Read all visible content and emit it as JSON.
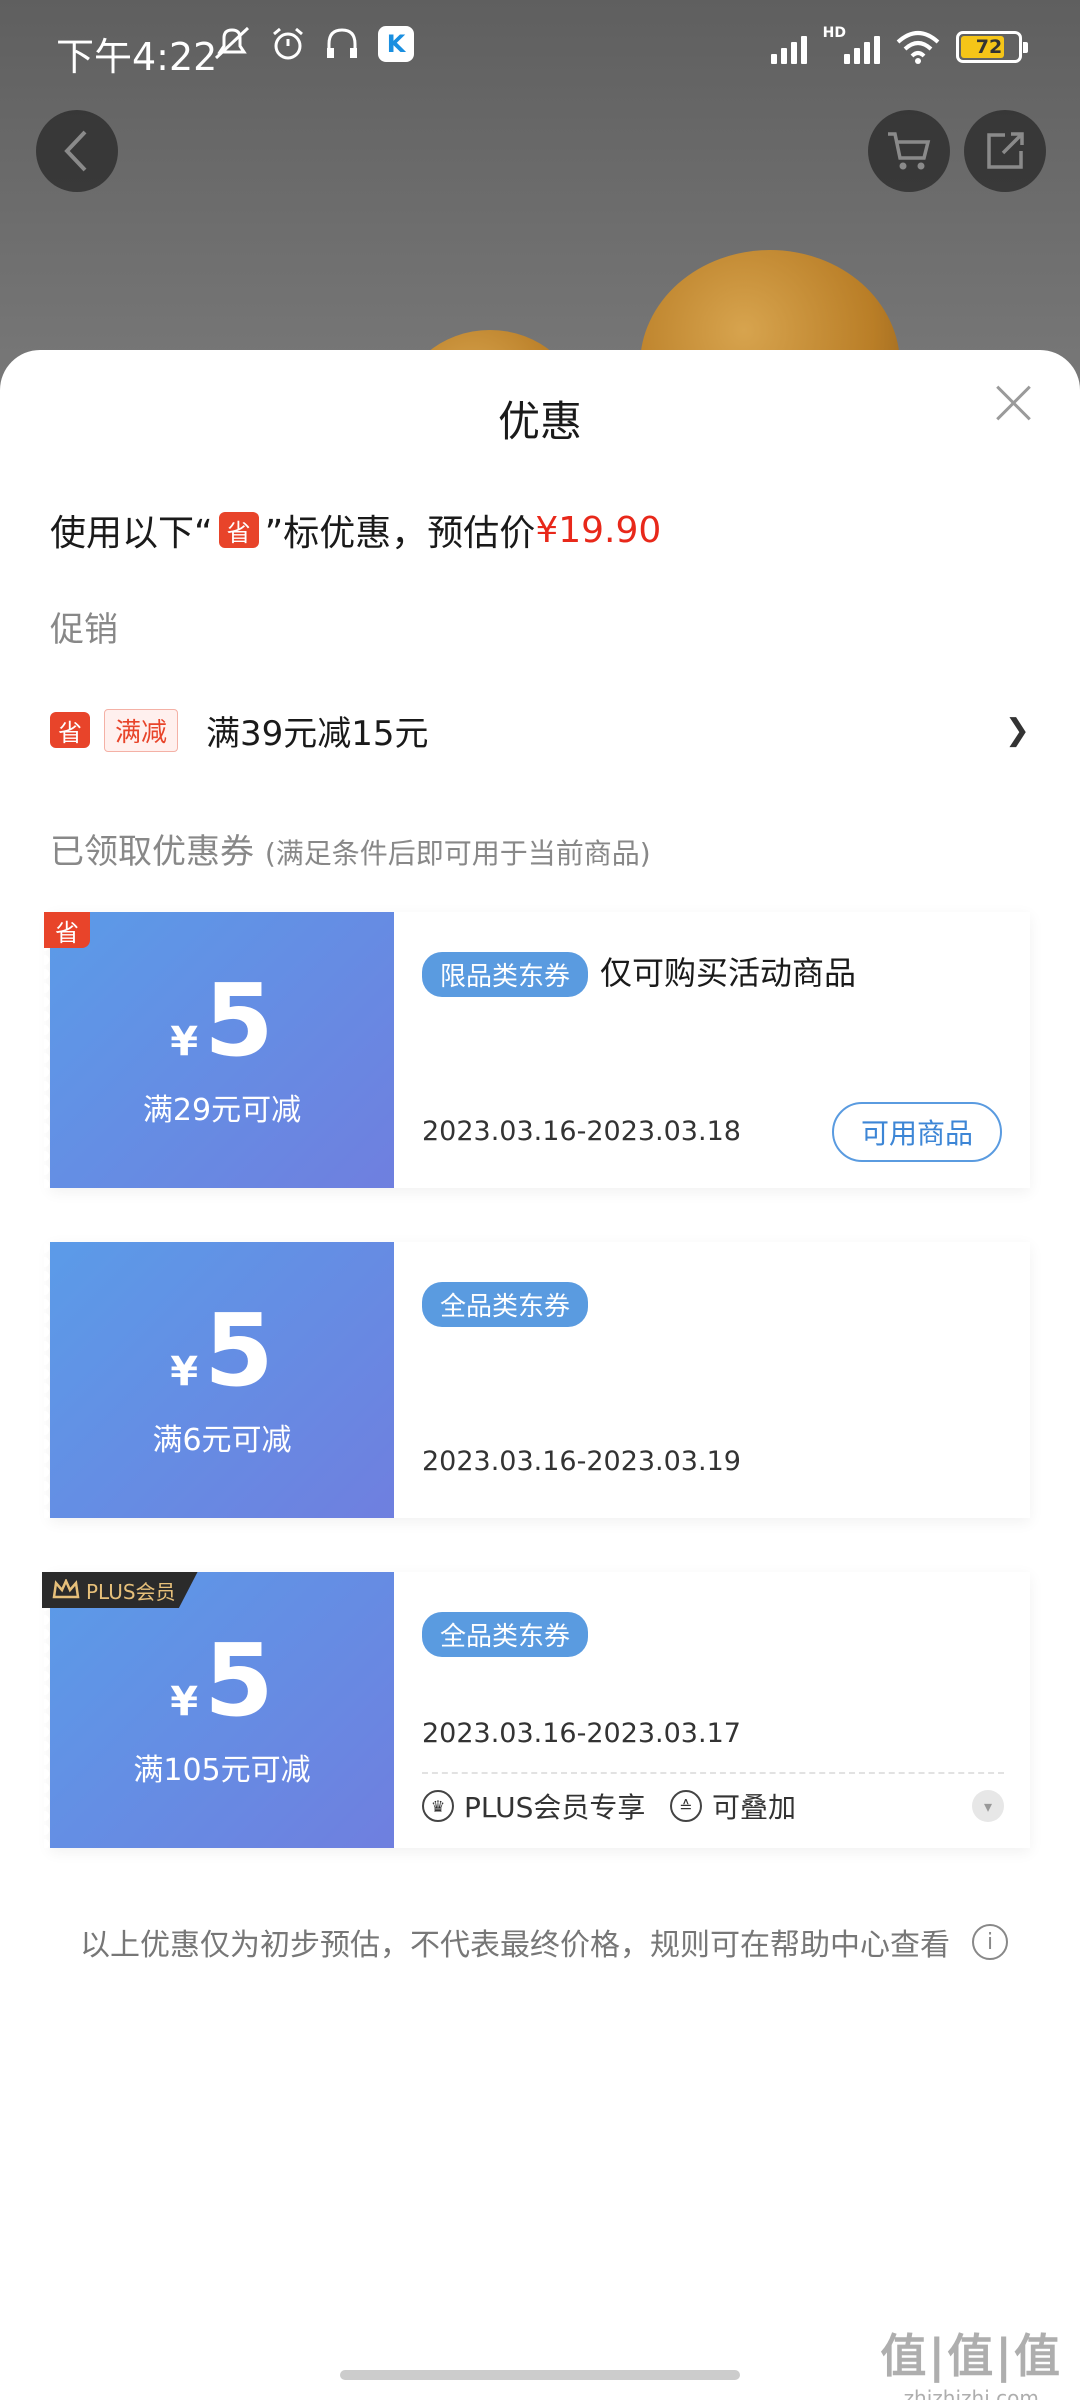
{
  "status_bar": {
    "time": "下午4:22",
    "battery": "72",
    "network": "HD"
  },
  "sheet": {
    "title": "优惠",
    "estimate": {
      "prefix": "使用以下“",
      "badge": "省",
      "suffix": "”标优惠，预估价",
      "price": "¥19.90"
    },
    "promo_label": "促销",
    "promo": {
      "badge": "省",
      "tag": "满减",
      "text": "满39元减15元"
    },
    "coupons_label": "已领取优惠券",
    "coupons_note": "(满足条件后即可用于当前商品)",
    "coupons": [
      {
        "corner": "省",
        "yen": "¥",
        "amount": "5",
        "condition": "满29元可减",
        "type": "限品类东券",
        "desc": "仅可购买活动商品",
        "date": "2023.03.16-2023.03.18",
        "button": "可用商品"
      },
      {
        "yen": "¥",
        "amount": "5",
        "condition": "满6元可减",
        "type": "全品类东券",
        "date": "2023.03.16-2023.03.19"
      },
      {
        "corner": "PLUS会员",
        "yen": "¥",
        "amount": "5",
        "condition": "满105元可减",
        "type": "全品类东券",
        "date": "2023.03.16-2023.03.17",
        "feature1": "PLUS会员专享",
        "feature2": "可叠加"
      }
    ],
    "disclaimer": "以上优惠仅为初步预估，不代表最终价格，规则可在帮助中心查看"
  },
  "watermark": {
    "big": "值|值|值",
    "small": "zhizhizhi.com"
  },
  "colors": {
    "price_red": "#e8281a",
    "coupon_blue": "#5b9be8",
    "badge_red": "#e8442a"
  }
}
